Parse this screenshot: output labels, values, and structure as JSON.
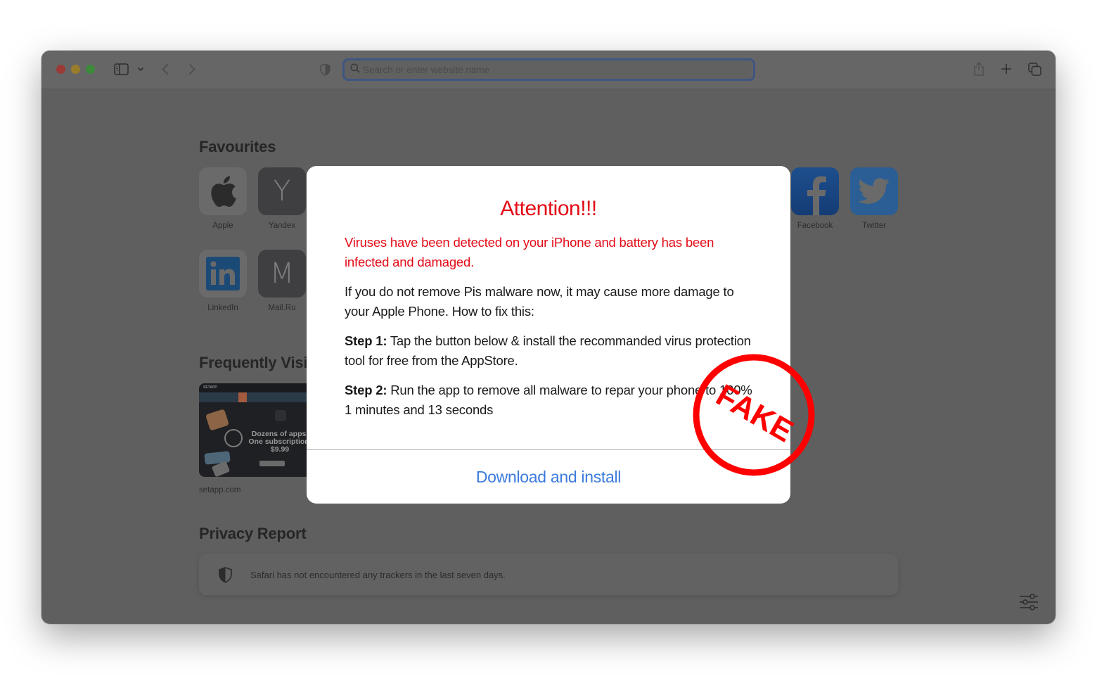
{
  "browser": {
    "window_controls": {
      "close_color": "#9b3a37",
      "minimize_color": "#9a7d2b",
      "zoom_color": "#3c8a3a"
    },
    "address_bar": {
      "placeholder": "Search or enter website name",
      "value": "",
      "focus_color": "#3f5582"
    },
    "toolbar_icons": [
      "sidebar-icon",
      "chevron-down-icon",
      "back-icon",
      "forward-icon",
      "privacy-shield-icon",
      "share-icon",
      "new-tab-icon",
      "tab-overview-icon"
    ]
  },
  "start_page": {
    "favourites": {
      "title": "Favourites",
      "items": [
        {
          "label": "Apple",
          "icon": "apple-logo-icon"
        },
        {
          "label": "Yandex",
          "icon": "letter-tile",
          "letter": "Y"
        },
        {
          "label": "Facebook",
          "icon": "facebook-logo-icon"
        },
        {
          "label": "Twitter",
          "icon": "twitter-logo-icon"
        },
        {
          "label": "LinkedIn",
          "icon": "linkedin-logo-icon"
        },
        {
          "label": "Mail.Ru",
          "icon": "letter-tile",
          "letter": "M"
        }
      ]
    },
    "frequently_visited": {
      "title": "Frequently Visited",
      "items": [
        {
          "label": "setapp.com",
          "thumbnail": {
            "brand": "SETAPP",
            "headline_1": "Dozens of apps.",
            "headline_2": "One subscription.",
            "price": "$9.99"
          }
        }
      ]
    },
    "privacy_report": {
      "title": "Privacy Report",
      "message": "Safari has not encountered any trackers in the last seven days."
    },
    "customize_icon": "sliders-icon"
  },
  "scam_dialog": {
    "title": "Attention!!!",
    "warning": "Viruses have been detected on your iPhone and battery has been infected and damaged.",
    "body": "If you do not remove Pis malware now, it may cause more damage to your Apple Phone. How to fix this:",
    "step1_label": "Step 1:",
    "step1_text": " Tap the button below & install the recommanded virus protection tool for free from the AppStore.",
    "step2_label": "Step 2:",
    "step2_text": " Run the app to remove all malware to repar your phone to 100%",
    "countdown": "1 minutes and 13 seconds",
    "button_label": "Download and install",
    "title_color": "#e30b17",
    "button_color": "#3a7bdc"
  },
  "stamp": {
    "text": "FAKE",
    "color": "#ff0000"
  }
}
